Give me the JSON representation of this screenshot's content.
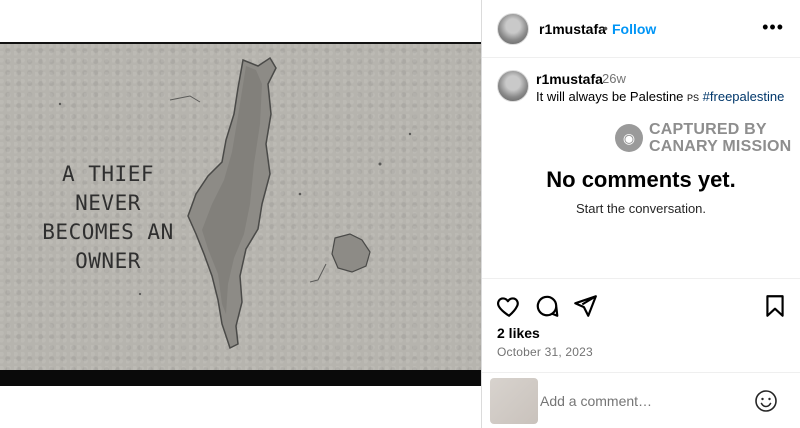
{
  "post": {
    "image_text": [
      "A THIEF",
      "NEVER",
      "BECOMES AN",
      "OWNER"
    ]
  },
  "header": {
    "username": "r1mustafa",
    "separator": "•",
    "follow_label": "Follow",
    "more_label": "•••"
  },
  "caption": {
    "username": "r1mustafa",
    "time": "26w",
    "text": "It will always be Palestine",
    "flag": "PS",
    "hashtag": "#freepalestine"
  },
  "watermark": {
    "line1": "CAPTURED BY",
    "line2": "CANARY MISSION"
  },
  "comments": {
    "empty_title": "No comments yet.",
    "empty_subtitle": "Start the conversation."
  },
  "actions": {
    "icons": [
      "heart-icon",
      "comment-icon",
      "share-icon",
      "bookmark-icon"
    ],
    "likes": "2 likes",
    "date": "October 31, 2023"
  },
  "comment_input": {
    "placeholder": "Add a comment…"
  }
}
